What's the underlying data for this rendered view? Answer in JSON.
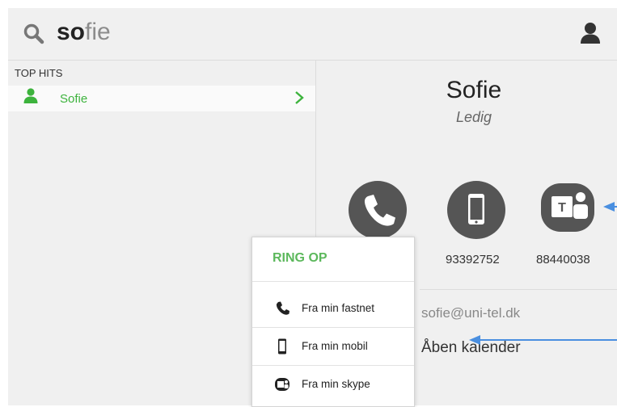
{
  "search": {
    "query_typed": "so",
    "query_suggest": "fie"
  },
  "results": {
    "section_label": "TOP HITS",
    "hits": [
      {
        "name": "Sofie"
      }
    ]
  },
  "contact": {
    "name": "Sofie",
    "status": "Ledig",
    "numbers": {
      "mobile": "93392752",
      "teams": "88440038"
    },
    "email": "sofie@uni-tel.dk",
    "calendar_link": "Åben kalender"
  },
  "call_menu": {
    "title": "RING OP",
    "options": [
      {
        "label": "Fra min fastnet",
        "icon": "landline-phone-icon"
      },
      {
        "label": "Fra min mobil",
        "icon": "mobile-phone-icon"
      },
      {
        "label": "Fra min skype",
        "icon": "skype-icon"
      }
    ]
  },
  "colors": {
    "accent_green": "#3db33d",
    "menu_title_green": "#5cb85c",
    "icon_dark": "#555555",
    "annotation_blue": "#4a8fe0"
  }
}
